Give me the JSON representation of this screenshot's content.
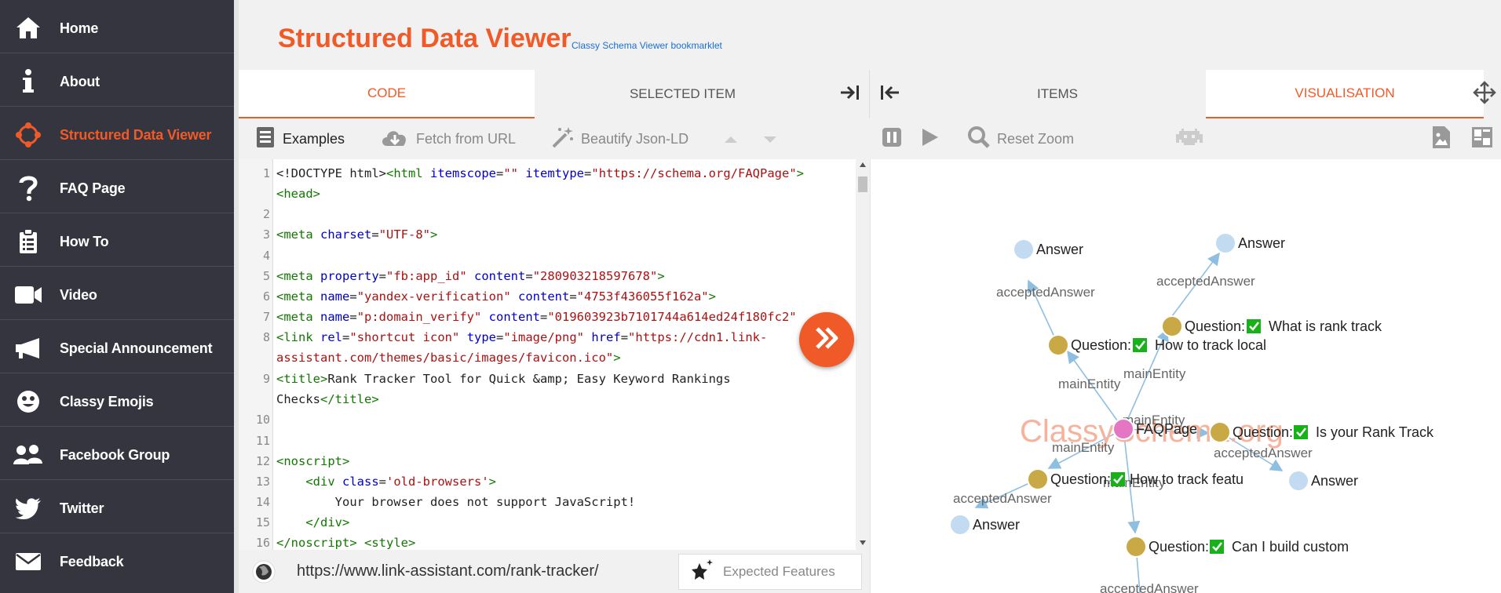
{
  "sidebar": {
    "items": [
      {
        "label": "Home",
        "icon": "home-icon"
      },
      {
        "label": "About",
        "icon": "info-icon"
      },
      {
        "label": "Structured Data Viewer",
        "icon": "target-icon",
        "active": true
      },
      {
        "label": "FAQ Page",
        "icon": "question-icon"
      },
      {
        "label": "How To",
        "icon": "clipboard-icon"
      },
      {
        "label": "Video",
        "icon": "video-icon"
      },
      {
        "label": "Special Announcement",
        "icon": "megaphone-icon"
      },
      {
        "label": "Classy Emojis",
        "icon": "emoji-icon"
      },
      {
        "label": "Facebook Group",
        "icon": "group-icon"
      },
      {
        "label": "Twitter",
        "icon": "twitter-icon"
      },
      {
        "label": "Feedback",
        "icon": "mail-icon"
      }
    ]
  },
  "header": {
    "title": "Structured Data Viewer",
    "bookmarklet": "Classy Schema Viewer bookmarklet"
  },
  "tabs": {
    "code": "CODE",
    "selected_item": "SELECTED ITEM",
    "items": "ITEMS",
    "visualisation": "VISUALISATION"
  },
  "toolbar": {
    "examples": "Examples",
    "fetch": "Fetch from URL",
    "beautify": "Beautify Json-LD",
    "reset_zoom": "Reset Zoom"
  },
  "editor": {
    "line_numbers": [
      "1",
      "",
      "2",
      "3",
      "4",
      "5",
      "6",
      "7",
      "8",
      "",
      "9",
      "",
      "10",
      "11",
      "12",
      "13",
      "14",
      "15",
      "16"
    ]
  },
  "url_bar": {
    "url": "https://www.link-assistant.com/rank-tracker/",
    "expected_features": "Expected Features"
  },
  "graph": {
    "watermark": "ClassySchema.org",
    "nodes": {
      "faq": "FAQPage",
      "q1_label": "Question:",
      "q1_text": "How to track local",
      "q2_label": "Question:",
      "q2_text": "What is rank track",
      "q3_label": "Question:",
      "q3_text": "Is your Rank Track",
      "q4_label": "Question:",
      "q4_text": "How to track featu",
      "q5_label": "Question:",
      "q5_text": "Can I build custom",
      "answer": "Answer"
    },
    "edges": {
      "main": "mainEntity",
      "accepted": "acceptedAnswer"
    },
    "colors": {
      "question": "#c9a945",
      "answer": "#c3dbf0",
      "page": "#e476c4",
      "edge": "#8fbfe0"
    }
  },
  "colors": {
    "accent": "#f05a28",
    "sidebar": "#34353f",
    "link": "#1a6fd6"
  }
}
